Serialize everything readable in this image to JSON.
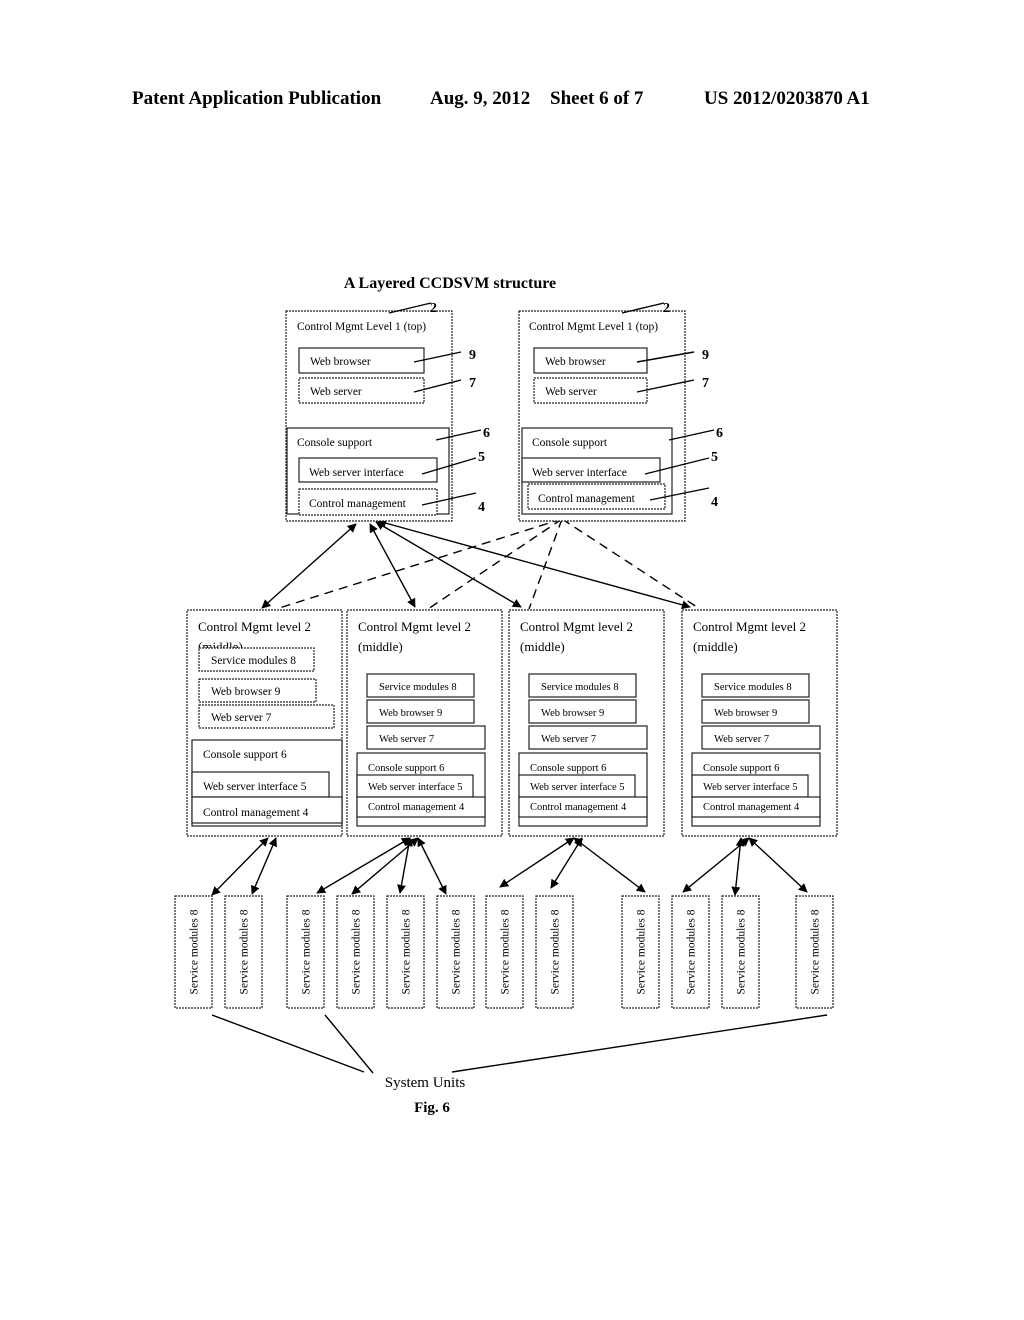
{
  "header": {
    "publication": "Patent Application Publication",
    "date": "Aug. 9, 2012",
    "sheet": "Sheet 6 of 7",
    "number": "US 2012/0203870 A1"
  },
  "figure": {
    "title": "A Layered CCDSVM structure",
    "caption": "Fig. 6",
    "system_units_label": "System Units"
  },
  "level1": [
    {
      "title": "Control Mgmt Level 1 (top)",
      "ref": "2",
      "items": [
        {
          "label": "Web browser",
          "ref": "9"
        },
        {
          "label": "Web server",
          "ref": "7"
        }
      ],
      "console": {
        "label": "Console support",
        "ref": "6"
      },
      "console_items": [
        {
          "label": "Web server interface",
          "ref": "5"
        },
        {
          "label": "Control management",
          "ref": "4"
        }
      ]
    },
    {
      "title": "Control Mgmt Level 1 (top)",
      "ref": "2",
      "items": [
        {
          "label": "Web browser",
          "ref": "9"
        },
        {
          "label": "Web server",
          "ref": "7"
        }
      ],
      "console": {
        "label": "Console support",
        "ref": "6"
      },
      "console_items": [
        {
          "label": "Web server interface",
          "ref": "5"
        },
        {
          "label": "Control management",
          "ref": "4"
        }
      ]
    }
  ],
  "level2": [
    {
      "title_line1": "Control Mgmt level 2",
      "title_line2": "(middle)",
      "items": [
        "Service modules 8",
        "Web browser  9",
        "Web server 7"
      ],
      "console": "Console support 6",
      "console_items": [
        "Web server interface 5",
        "Control management  4"
      ]
    },
    {
      "title_line1": "Control Mgmt level 2",
      "title_line2": "(middle)",
      "items": [
        "Service modules 8",
        "Web browser  9",
        "Web server 7"
      ],
      "console": "Console support 6",
      "console_items": [
        "Web server interface 5",
        "Control management  4"
      ]
    },
    {
      "title_line1": "Control Mgmt level 2",
      "title_line2": "(middle)",
      "items": [
        "Service modules 8",
        "Web browser  9",
        "Web server 7"
      ],
      "console": "Console support 6",
      "console_items": [
        "Web server interface 5",
        "Control management  4"
      ]
    },
    {
      "title_line1": "Control Mgmt level 2",
      "title_line2": "(middle)",
      "items": [
        "Service modules 8",
        "Web browser  9",
        "Web server 7"
      ],
      "console": "Console support 6",
      "console_items": [
        "Web server interface 5",
        "Control management  4"
      ]
    }
  ],
  "service_modules": [
    {
      "label": "Service modules 8",
      "parent": 0
    },
    {
      "label": "Service modules 8",
      "parent": 0
    },
    {
      "label": "Service modules 8",
      "parent": 1
    },
    {
      "label": "Service modules 8",
      "parent": 1
    },
    {
      "label": "Service modules 8",
      "parent": 1
    },
    {
      "label": "Service modules 8",
      "parent": 1
    },
    {
      "label": "Service modules 8",
      "parent": 2
    },
    {
      "label": "Service modules 8",
      "parent": 2
    },
    {
      "label": "Service modules 8",
      "parent": 2
    },
    {
      "label": "Service modules 8",
      "parent": 3
    },
    {
      "label": "Service modules 8",
      "parent": 3
    },
    {
      "label": "Service modules 8",
      "parent": 3
    }
  ],
  "connections": {
    "level1_to_level2_solid": {
      "from": 0,
      "to": [
        0,
        1,
        2,
        3
      ]
    },
    "level1_to_level2_dashed": {
      "from": 1,
      "to": [
        0,
        1,
        2,
        3
      ]
    },
    "system_units_pointers": [
      0,
      2,
      11
    ]
  }
}
